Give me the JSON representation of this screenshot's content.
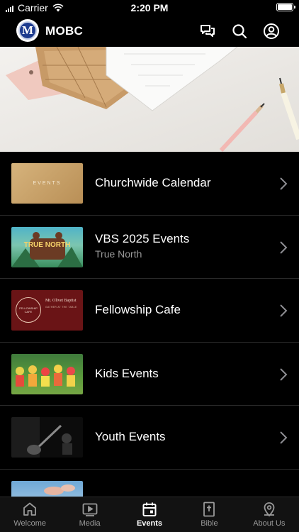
{
  "status_bar": {
    "carrier": "Carrier",
    "time": "2:20 PM"
  },
  "header": {
    "logo_letter": "M",
    "title": "MOBC"
  },
  "list": [
    {
      "title": "Churchwide Calendar",
      "subtitle": "",
      "thumb_text": "EVENTS"
    },
    {
      "title": "VBS 2025 Events",
      "subtitle": "True North",
      "thumb_text": "TRUE NORTH"
    },
    {
      "title": "Fellowship Cafe",
      "subtitle": "",
      "thumb_text": "Mt. Olivet Baptist",
      "thumb_subtext": "GATHER AT THE TABLE",
      "thumb_badge": "FELLOWSHIP CAFE"
    },
    {
      "title": "Kids Events",
      "subtitle": ""
    },
    {
      "title": "Youth Events",
      "subtitle": ""
    }
  ],
  "tabbar": [
    {
      "label": "Welcome",
      "icon": "home-icon",
      "active": false
    },
    {
      "label": "Media",
      "icon": "play-icon",
      "active": false
    },
    {
      "label": "Events",
      "icon": "calendar-icon",
      "active": true
    },
    {
      "label": "Bible",
      "icon": "bible-icon",
      "active": false
    },
    {
      "label": "About Us",
      "icon": "location-pin-icon",
      "active": false
    }
  ]
}
